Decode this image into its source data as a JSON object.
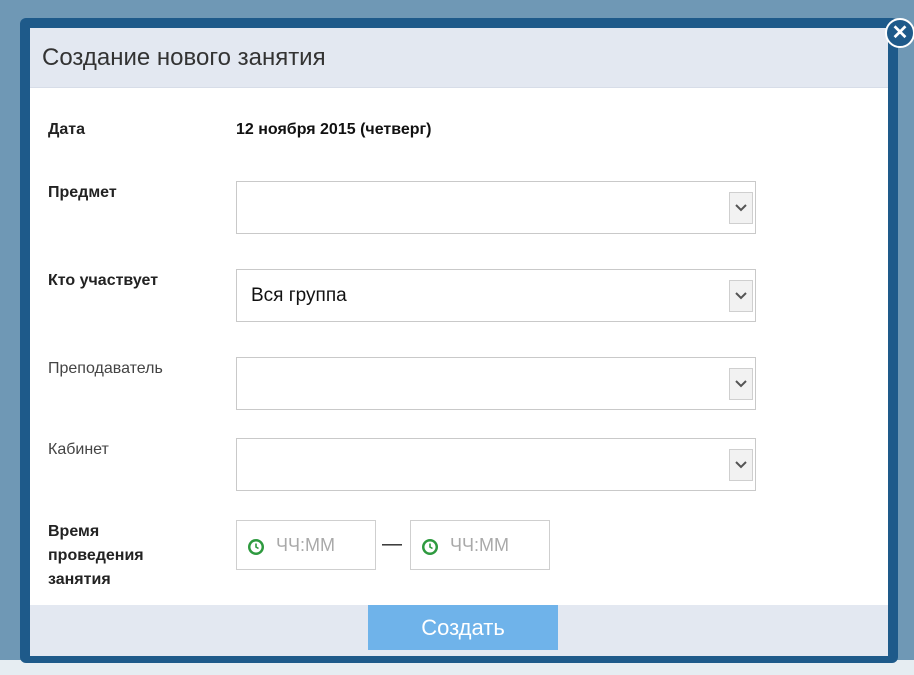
{
  "dialog": {
    "title": "Создание нового занятия"
  },
  "fields": {
    "date": {
      "label": "Дата",
      "value": "12 ноября 2015 (четверг)"
    },
    "subject": {
      "label": "Предмет",
      "value": ""
    },
    "participants": {
      "label": "Кто участвует",
      "value": "Вся группа"
    },
    "teacher": {
      "label": "Преподаватель",
      "value": ""
    },
    "room": {
      "label": "Кабинет",
      "value": ""
    },
    "time": {
      "label_line1": "Время",
      "label_line2": "проведения",
      "label_line3": "занятия",
      "start_placeholder": "ЧЧ:ММ",
      "separator": "—",
      "end_placeholder": "ЧЧ:ММ"
    }
  },
  "footer": {
    "create_label": "Создать"
  },
  "colors": {
    "frame": "#1e5a8a",
    "header": "#e3e8f1",
    "button": "#6fb3ea",
    "clock": "#2e9a3f"
  }
}
